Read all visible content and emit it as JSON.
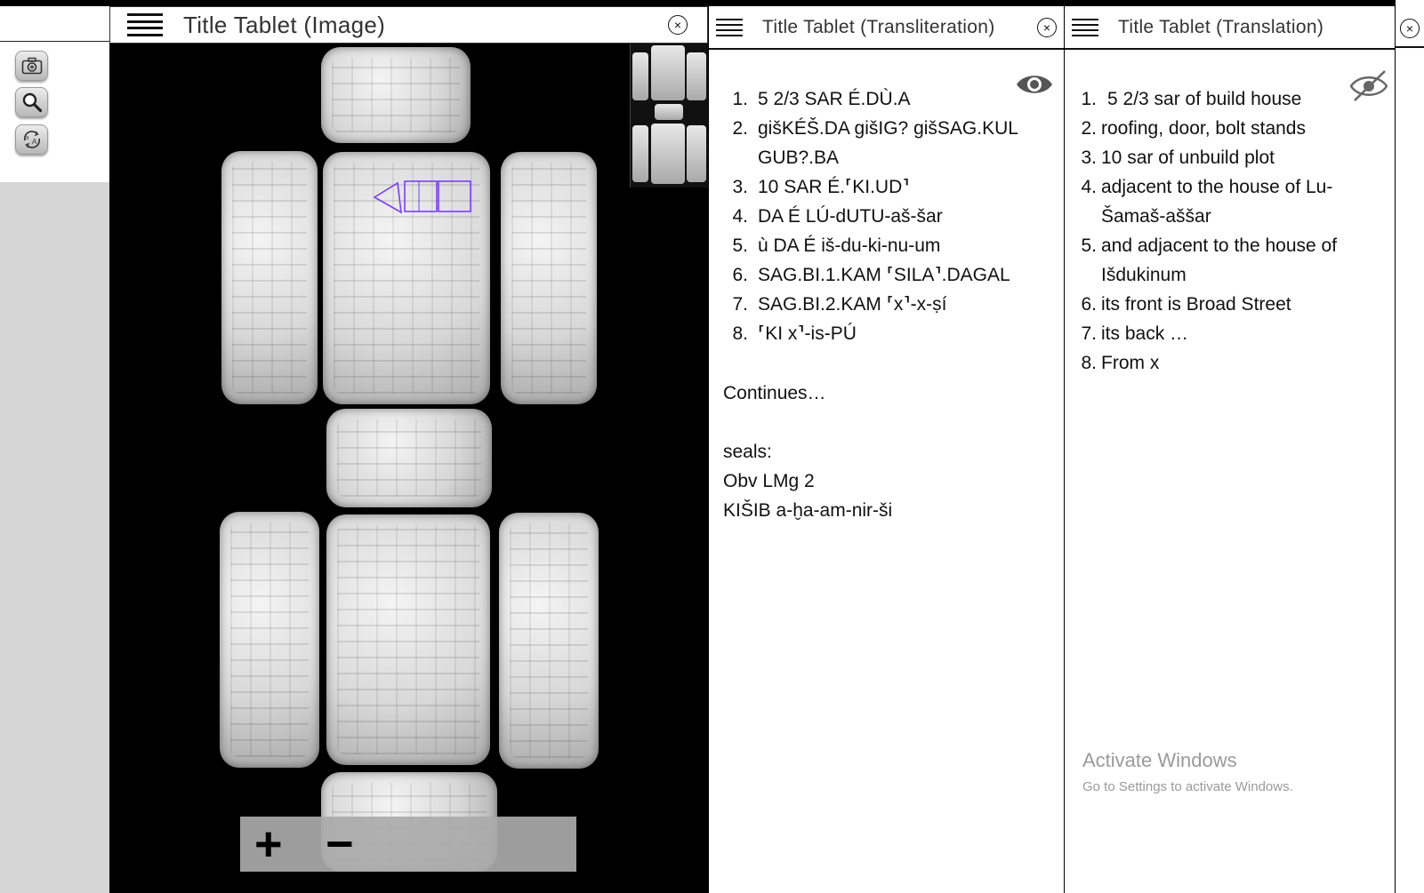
{
  "toolbar": {
    "tools": [
      {
        "icon": "camera-icon"
      },
      {
        "icon": "zoom-icon"
      },
      {
        "icon": "translate-icon"
      }
    ]
  },
  "image_panel": {
    "title": "Title Tablet (Image)",
    "close_glyph": "×",
    "zoom_in_label": "+",
    "zoom_out_label": "−"
  },
  "translit_panel": {
    "title": "Title Tablet (Transliteration)",
    "close_glyph": "×",
    "eye_state": "visible",
    "lines": [
      {
        "n": "1.",
        "text": "5 2/3 SAR É.DÙ.A"
      },
      {
        "n": "2.",
        "text": "gišKÉŠ.DA gišIG? gišSAG.KUL GUB?.BA"
      },
      {
        "n": "3.",
        "text": "10 SAR É.⸢KI.UD⸣"
      },
      {
        "n": "4.",
        "text": "DA É LÚ-dUTU-aš-šar"
      },
      {
        "n": "5.",
        "text": "ù DA É iš-du-ki-nu-um"
      },
      {
        "n": "6.",
        "text": "SAG.BI.1.KAM ⸢SILA⸣.DAGAL"
      },
      {
        "n": "7.",
        "text": "SAG.BI.2.KAM ⸢x⸣-x-ṣí"
      },
      {
        "n": "8.",
        "text": "⸢KI x⸣-is-PÚ"
      }
    ],
    "continues": "Continues…",
    "seals_label": "seals:",
    "seal_lines": [
      "Obv LMg 2",
      "KIŠIB a-ḫa-am-nir-ši"
    ]
  },
  "translation_panel": {
    "title": "Title Tablet (Translation)",
    "close_glyph": "×",
    "eye_state": "hidden",
    "lines": [
      {
        "n": "1.",
        "text": "5 2/3 sar of build house"
      },
      {
        "n": "2.",
        "text": "roofing, door, bolt stands"
      },
      {
        "n": "3.",
        "text": "10 sar of unbuild plot"
      },
      {
        "n": "4.",
        "text": "adjacent to the house of Lu-Šamaš-aššar"
      },
      {
        "n": "5.",
        "text": "and adjacent to the house of Išdukinum"
      },
      {
        "n": "6.",
        "text": "its front is Broad Street"
      },
      {
        "n": "7.",
        "text": "its back …"
      },
      {
        "n": "8.",
        "text": "From x"
      }
    ]
  },
  "watermark": {
    "title": "Activate Windows",
    "subtitle": "Go to Settings to activate Windows."
  },
  "colors": {
    "bbox_highlight": "#7a3cff",
    "toolbar_bg": "#d6d6d6",
    "viewport_bg": "#000000"
  }
}
